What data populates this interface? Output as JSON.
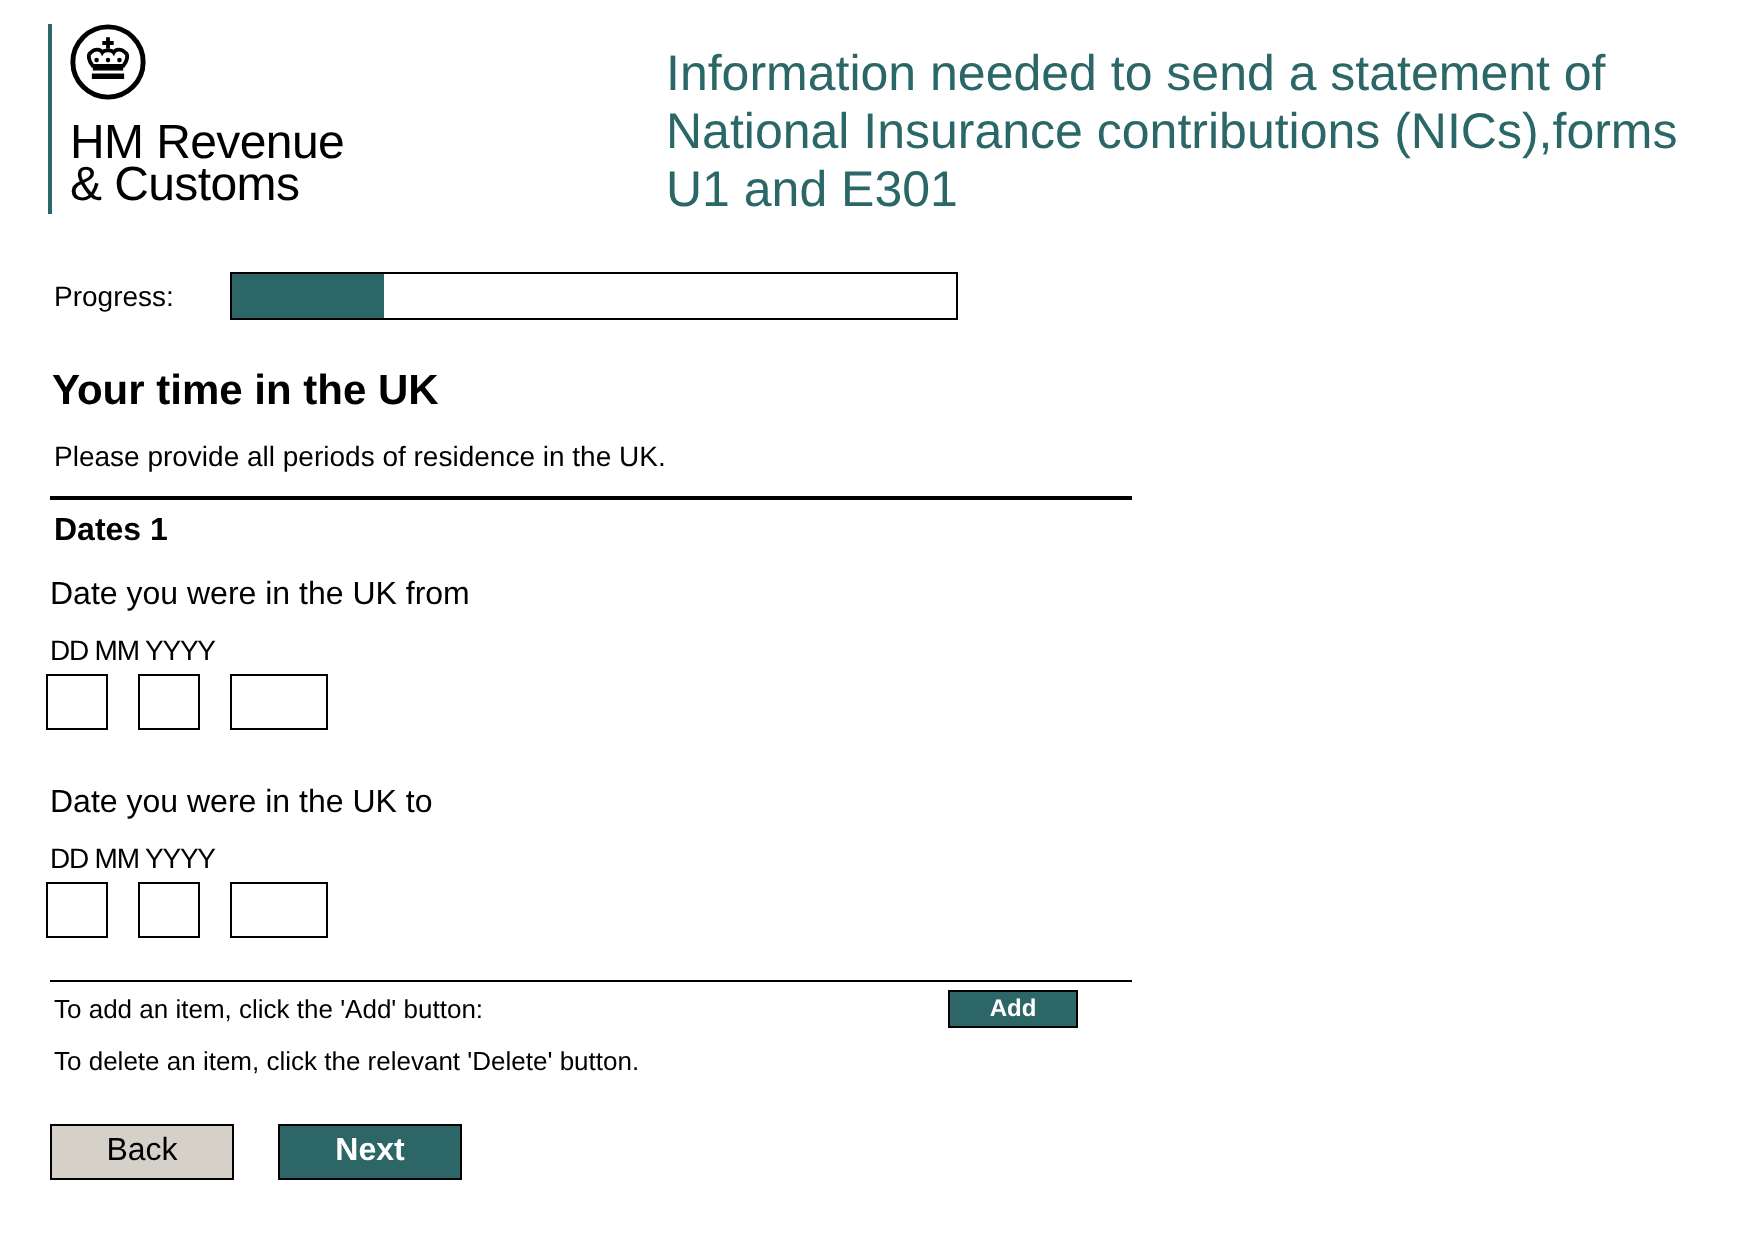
{
  "header": {
    "logo_lines": [
      "HM Revenue",
      "& Customs"
    ],
    "title": "Information needed to send a statement of National Insurance contributions (NICs),forms U1 and E301"
  },
  "progress": {
    "label": "Progress:",
    "level": 0.21
  },
  "section": {
    "heading": "Your time in the UK",
    "intro": "Please provide all periods of residence in the UK."
  },
  "items": [
    {
      "title": "Dates 1",
      "dates": [
        {
          "label": "Date you were in the UK from",
          "hint": "DD MM YYYY",
          "inputs": [
            {
              "kind": "day"
            },
            {
              "kind": "month"
            },
            {
              "kind": "year"
            }
          ]
        },
        {
          "label": "Date you were in the UK to",
          "hint": "DD MM YYYY",
          "inputs": [
            {
              "kind": "day"
            },
            {
              "kind": "month"
            },
            {
              "kind": "year"
            }
          ]
        }
      ]
    }
  ],
  "add_row": {
    "text": "To add an item, click the 'Add' button:",
    "button": "Add"
  },
  "delete_note": "To delete an item, click the relevant 'Delete' button.",
  "buttons": [
    {
      "label": "Back",
      "kind": "secondary"
    },
    {
      "label": "Next",
      "kind": "primary"
    }
  ]
}
